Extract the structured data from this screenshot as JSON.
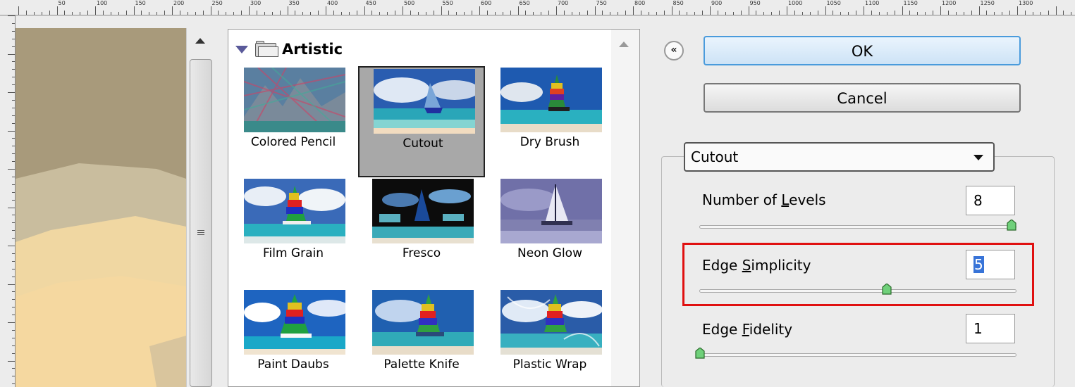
{
  "ruler": {
    "labels": [
      "50",
      "100",
      "150",
      "200",
      "250",
      "300",
      "350",
      "400",
      "450",
      "500",
      "550",
      "600",
      "650",
      "700",
      "750",
      "800",
      "850",
      "900",
      "950",
      "1000",
      "1050",
      "1100",
      "1150",
      "1200",
      "1250",
      "1300"
    ]
  },
  "gallery": {
    "category": "Artistic",
    "filters": [
      {
        "label": "Colored Pencil",
        "selected": false
      },
      {
        "label": "Cutout",
        "selected": true
      },
      {
        "label": "Dry Brush",
        "selected": false
      },
      {
        "label": "Film Grain",
        "selected": false
      },
      {
        "label": "Fresco",
        "selected": false
      },
      {
        "label": "Neon Glow",
        "selected": false
      },
      {
        "label": "Paint Daubs",
        "selected": false
      },
      {
        "label": "Palette Knife",
        "selected": false
      },
      {
        "label": "Plastic Wrap",
        "selected": false
      }
    ]
  },
  "buttons": {
    "ok": "OK",
    "cancel": "Cancel",
    "collapse": "«"
  },
  "settings": {
    "filter_select": "Cutout",
    "params": [
      {
        "label": "Number of Levels",
        "mnemonic": "L",
        "value": "8",
        "fraction": 1.0
      },
      {
        "label": "Edge Simplicity",
        "mnemonic": "S",
        "value": "5",
        "fraction": 0.6
      },
      {
        "label": "Edge Fidelity",
        "mnemonic": "F",
        "value": "1",
        "fraction": 0.0
      }
    ]
  },
  "colors": {
    "highlight": "#e01010",
    "selection": "#3874d8",
    "ok_border": "#4a9bdc"
  }
}
